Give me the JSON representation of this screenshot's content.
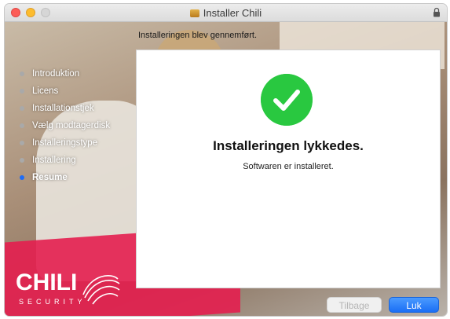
{
  "window": {
    "title": "Installer Chili",
    "title_icon": "package-icon",
    "lock_icon": "lock-icon"
  },
  "header": {
    "status_text": "Installeringen blev gennemført."
  },
  "sidebar": {
    "steps": [
      {
        "label": "Introduktion",
        "active": false
      },
      {
        "label": "Licens",
        "active": false
      },
      {
        "label": "Installationstjek",
        "active": false
      },
      {
        "label": "Vælg modtagerdisk",
        "active": false
      },
      {
        "label": "Installeringstype",
        "active": false
      },
      {
        "label": "Installering",
        "active": false
      },
      {
        "label": "Resume",
        "active": true
      }
    ]
  },
  "main": {
    "success_icon": "checkmark-circle-icon",
    "title": "Installeringen lykkedes.",
    "subtitle": "Softwaren er installeret."
  },
  "logo": {
    "name": "CHILI",
    "tagline": "SECURITY"
  },
  "buttons": {
    "back_label": "Tilbage",
    "close_label": "Luk"
  },
  "colors": {
    "accent": "#1e6cf5",
    "success": "#29c840",
    "brand": "#e41e4f"
  }
}
